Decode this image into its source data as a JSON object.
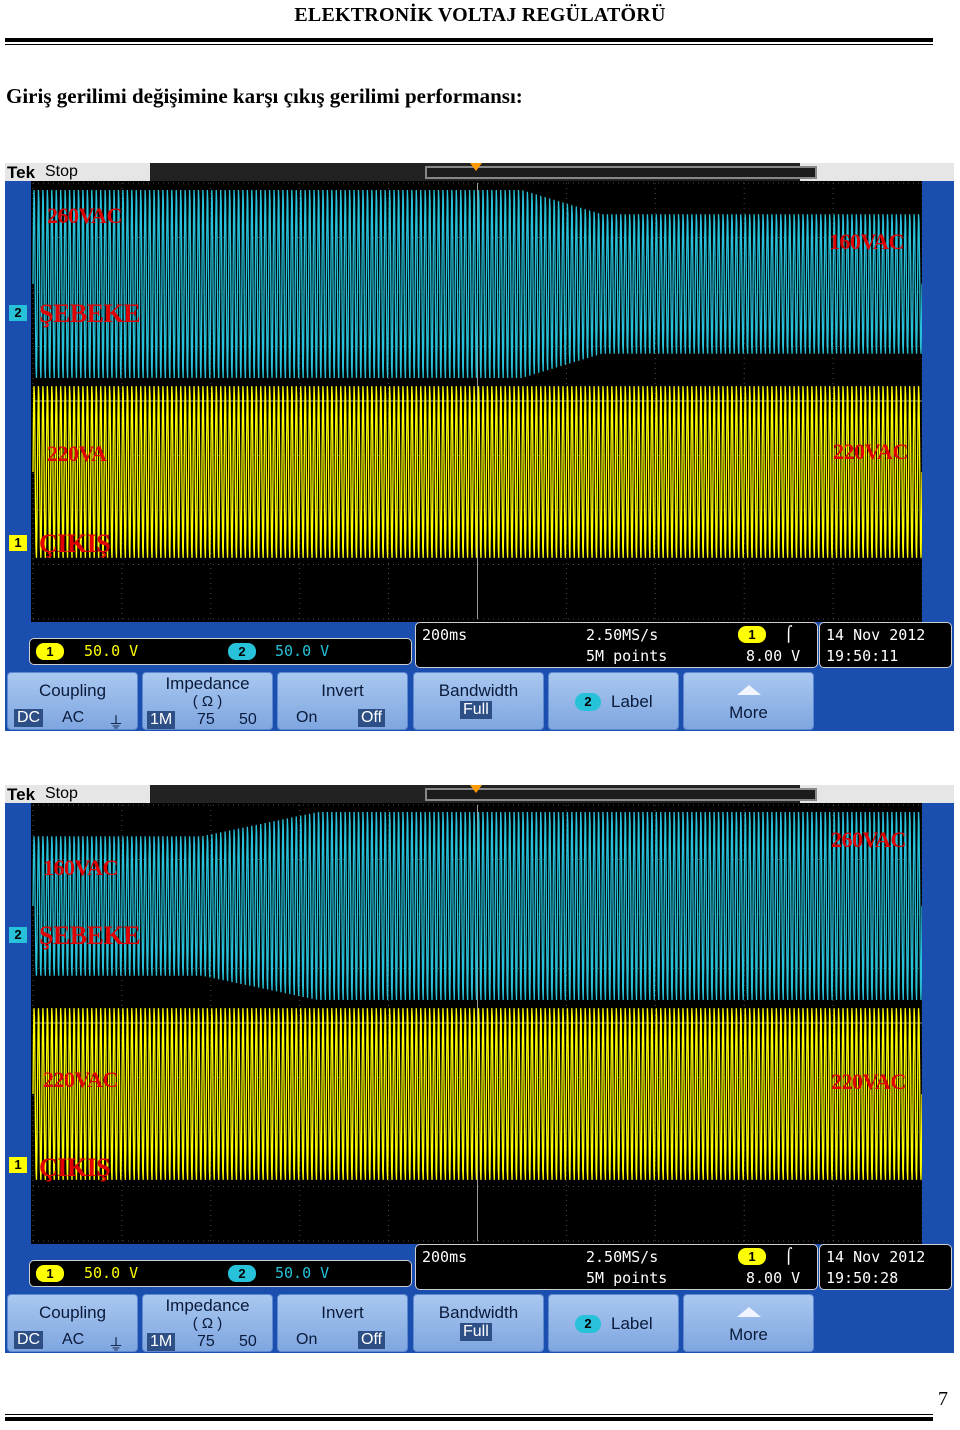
{
  "header": {
    "title": "ELEKTRONİK VOLTAJ REGÜLATÖRÜ"
  },
  "section": {
    "title": "Giriş gerilimi değişimine karşı çıkış gerilimi performansı:"
  },
  "scopes": [
    {
      "brand": "Tek",
      "status": "Stop",
      "annotations": {
        "top_left": "260VAC",
        "top_right": "160VAC",
        "input_label": "ŞEBEKE",
        "bottom_left": "220VA",
        "bottom_right": "220VAC",
        "output_label": "ÇIKIŞ"
      },
      "ch2_marker": "2",
      "ch1_marker": "1",
      "scale": {
        "ch1_badge": "1",
        "ch1_value": "50.0 V",
        "ch2_badge": "2",
        "ch2_value": "50.0 V"
      },
      "timebase": {
        "time_div": "200ms",
        "sample_rate": "2.50MS/s",
        "record": "5M points",
        "trigger_badge": "1",
        "trigger_slope": "⌠",
        "trigger_level": "8.00 V"
      },
      "datetime": {
        "date": "14 Nov 2012",
        "time": "19:50:11"
      },
      "menu": {
        "coupling": {
          "label": "Coupling",
          "opt_dc": "DC",
          "opt_ac": "AC",
          "opt_gnd": "⏚"
        },
        "impedance": {
          "label": "Impedance",
          "unit": "( Ω )",
          "opt_1m": "1M",
          "opt_75": "75",
          "opt_50": "50"
        },
        "invert": {
          "label": "Invert",
          "opt_on": "On",
          "opt_off": "Off"
        },
        "bandwidth": {
          "label": "Bandwidth",
          "value": "Full"
        },
        "label_btn": {
          "badge": "2",
          "label": "Label"
        },
        "more": {
          "label": "More"
        }
      },
      "waveform": {
        "ch2_start_amplitude_div": 1.75,
        "ch2_end_amplitude_div": 1.3,
        "ch2_transition": [
          0.55,
          0.64
        ],
        "ch1_amplitude_div": 1.6
      }
    },
    {
      "brand": "Tek",
      "status": "Stop",
      "annotations": {
        "top_left": "160VAC",
        "top_right": "260VAC",
        "input_label": "ŞEBEKE",
        "bottom_left": "220VAC",
        "bottom_right": "220VAC",
        "output_label": "ÇIKIŞ"
      },
      "ch2_marker": "2",
      "ch1_marker": "1",
      "scale": {
        "ch1_badge": "1",
        "ch1_value": "50.0 V",
        "ch2_badge": "2",
        "ch2_value": "50.0 V"
      },
      "timebase": {
        "time_div": "200ms",
        "sample_rate": "2.50MS/s",
        "record": "5M points",
        "trigger_badge": "1",
        "trigger_slope": "⌠",
        "trigger_level": "8.00 V"
      },
      "datetime": {
        "date": "14 Nov 2012",
        "time": "19:50:28"
      },
      "menu": {
        "coupling": {
          "label": "Coupling",
          "opt_dc": "DC",
          "opt_ac": "AC",
          "opt_gnd": "⏚"
        },
        "impedance": {
          "label": "Impedance",
          "unit": "( Ω )",
          "opt_1m": "1M",
          "opt_75": "75",
          "opt_50": "50"
        },
        "invert": {
          "label": "Invert",
          "opt_on": "On",
          "opt_off": "Off"
        },
        "bandwidth": {
          "label": "Bandwidth",
          "value": "Full"
        },
        "label_btn": {
          "badge": "2",
          "label": "Label"
        },
        "more": {
          "label": "More"
        }
      },
      "waveform": {
        "ch2_start_amplitude_div": 1.3,
        "ch2_end_amplitude_div": 1.75,
        "ch2_transition": [
          0.19,
          0.32
        ],
        "ch1_amplitude_div": 1.6
      }
    }
  ],
  "footer": {
    "page_number": "7"
  },
  "colors": {
    "ch1": "#ffff00",
    "ch2": "#27c2d9",
    "annotation": "#e00000",
    "scope_frame": "#1a4fb0"
  }
}
